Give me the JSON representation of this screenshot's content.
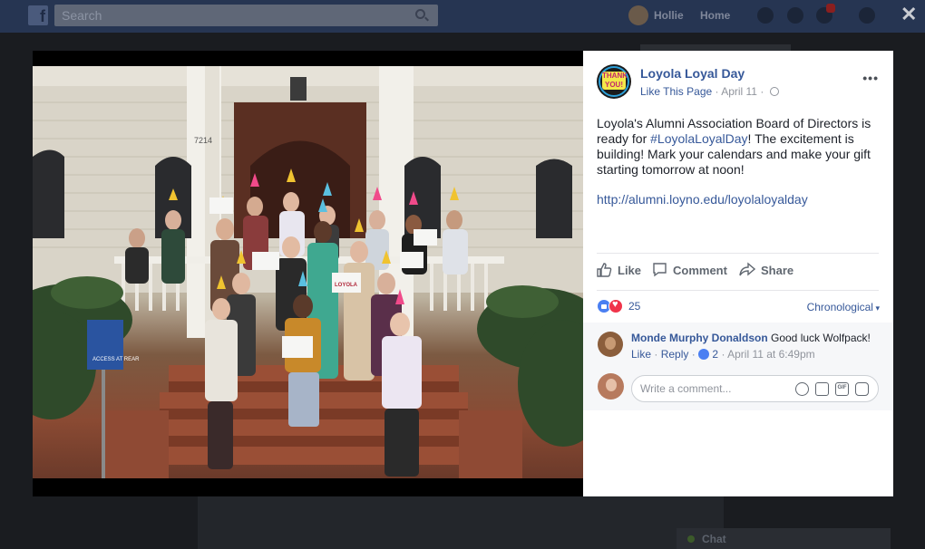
{
  "topbar": {
    "search_placeholder": "Search",
    "user_name": "Hollie",
    "home_label": "Home"
  },
  "post": {
    "page_name": "Loyola Loyal Day",
    "like_page": "Like This Page",
    "date": "April 11",
    "text_part1": "Loyola's Alumni Association Board of Directors is ready for ",
    "hashtag": "#LoyolaLoyalDay",
    "text_part2": "! The excitement is building! Mark your calendars and make your gift starting tomorrow at noon!",
    "link": "http://alumni.loyno.edu/loyolaloyalday",
    "avatar_text": "THANK YOU!"
  },
  "actions": {
    "like": "Like",
    "comment": "Comment",
    "share": "Share"
  },
  "reactions": {
    "count": "25",
    "sort": "Chronological"
  },
  "comment": {
    "author": "Monde Murphy Donaldson",
    "text": "Good luck Wolfpack!",
    "like": "Like",
    "reply": "Reply",
    "likes": "2",
    "date": "April 11 at 6:49pm"
  },
  "write_comment": {
    "placeholder": "Write a comment..."
  },
  "photo": {
    "sign_text": "ACCESS AT REAR",
    "house_number": "7214",
    "held_sign": "LOYOLA"
  },
  "chat": {
    "label": "Chat"
  },
  "colors": {
    "link_blue": "#365899",
    "topbar": "#263552",
    "like_blue": "#4a7ff2",
    "love_red": "#f0344a"
  }
}
